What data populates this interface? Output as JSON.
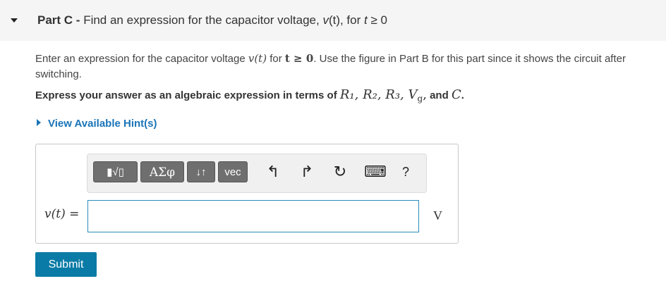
{
  "header": {
    "part_label": "Part C",
    "separator": " - ",
    "title_text": "Find an expression for the capacitor voltage, ",
    "title_var": "v",
    "title_paren": "(t)",
    "title_for": ", for ",
    "title_t": "t",
    "title_cond": " ≥ 0"
  },
  "instructions": {
    "line1_a": "Enter an expression for the capacitor voltage ",
    "math_v": "v(t)",
    "line1_for": " for ",
    "math_cond": "t ≥ 0",
    "line1_b": ". Use the figure in Part B for this part since it shows the circuit after switching.",
    "line2_a": "Express your answer as an algebraic expression in terms of ",
    "math_vars": "R₁, R₂, R₃, V",
    "math_vars_sub": "g",
    "math_comma": ",",
    "line2_and": " and ",
    "math_c": "C",
    "line2_end": "."
  },
  "hint": {
    "label": "View Available Hint(s)"
  },
  "toolbar": {
    "templates": "▮√▯",
    "greek": "ΑΣφ",
    "arrows": "↓↑",
    "vec": "vec",
    "undo": "↰",
    "redo": "↱",
    "reset": "↻",
    "keyboard": "⌨",
    "help": "?"
  },
  "answer": {
    "label": "v(t) =",
    "value": "",
    "unit": "V"
  },
  "submit": {
    "label": "Submit"
  }
}
